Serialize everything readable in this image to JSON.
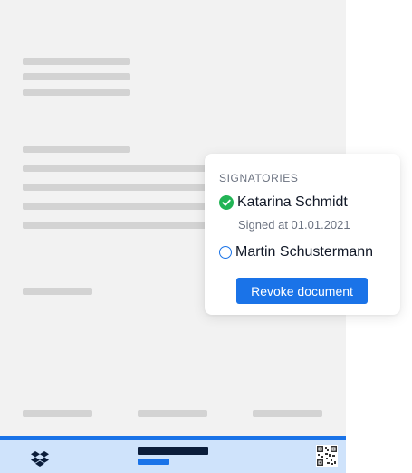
{
  "signatories": {
    "title": "SIGNATORIES",
    "items": [
      {
        "name": "Katarina Schmidt",
        "status": "signed",
        "status_icon": "check-circle-icon",
        "signed_text": "Signed at 01.01.2021"
      },
      {
        "name": "Martin Schustermann",
        "status": "pending",
        "status_icon": "empty-circle-icon"
      }
    ],
    "revoke_label": "Revoke document"
  },
  "colors": {
    "accent": "#1a73e8",
    "success": "#22b455",
    "footer_bg": "#cfe3fb",
    "document_bg": "#f2f2f2",
    "placeholder_line": "#d3d3d3"
  },
  "footer": {
    "logo_icon": "dropbox-logo-icon",
    "qr_icon": "qr-code-icon"
  }
}
